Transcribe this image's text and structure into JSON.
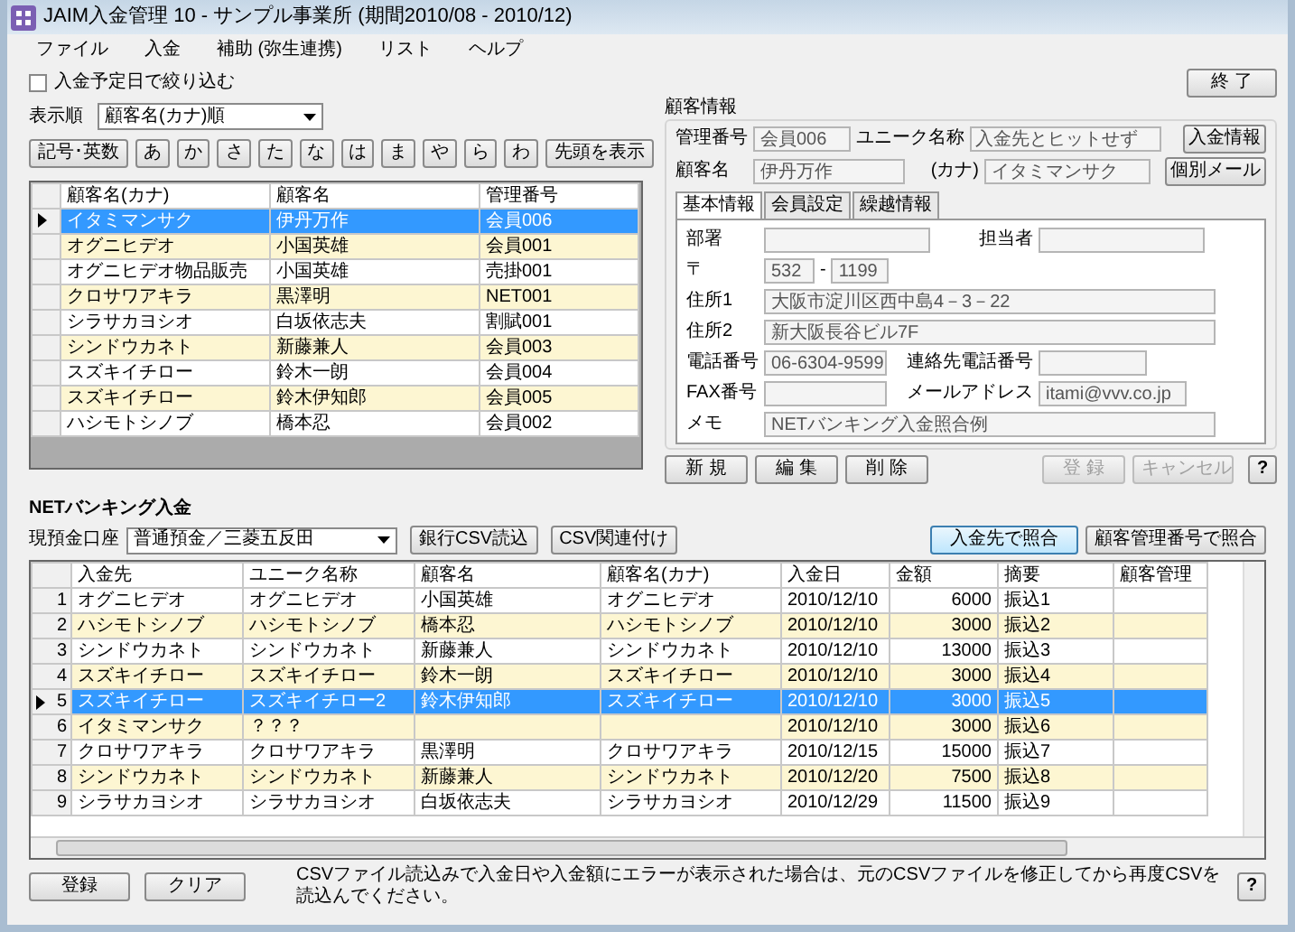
{
  "window": {
    "title": "JAIM入金管理 10  - サンプル事業所 (期間2010/08 - 2010/12)"
  },
  "menu": [
    "ファイル",
    "入金",
    "補助 (弥生連携)",
    "リスト",
    "ヘルプ"
  ],
  "filter": {
    "label": "入金予定日で絞り込む",
    "checked": false
  },
  "sort": {
    "label": "表示順",
    "value": "顧客名(カナ)順"
  },
  "index_buttons": [
    "記号･英数",
    "あ",
    "か",
    "さ",
    "た",
    "な",
    "は",
    "ま",
    "や",
    "ら",
    "わ"
  ],
  "show_top_button": "先頭を表示",
  "customers": {
    "columns": [
      "顧客名(カナ)",
      "顧客名",
      "管理番号"
    ],
    "rows": [
      {
        "cells": [
          "イタミマンサク",
          "伊丹万作",
          "会員006"
        ],
        "selected": true
      },
      {
        "cells": [
          "オグニヒデオ",
          "小国英雄",
          "会員001"
        ],
        "selected": false
      },
      {
        "cells": [
          "オグニヒデオ物品販売",
          "小国英雄",
          "売掛001"
        ],
        "selected": false
      },
      {
        "cells": [
          "クロサワアキラ",
          "黒澤明",
          "NET001"
        ],
        "selected": false
      },
      {
        "cells": [
          "シラサカヨシオ",
          "白坂依志夫",
          "割賦001"
        ],
        "selected": false
      },
      {
        "cells": [
          "シンドウカネト",
          "新藤兼人",
          "会員003"
        ],
        "selected": false
      },
      {
        "cells": [
          "スズキイチロー",
          "鈴木一朗",
          "会員004"
        ],
        "selected": false
      },
      {
        "cells": [
          "スズキイチロー",
          "鈴木伊知郎",
          "会員005"
        ],
        "selected": false
      },
      {
        "cells": [
          "ハシモトシノブ",
          "橋本忍",
          "会員002"
        ],
        "selected": false
      }
    ]
  },
  "exit_button": "終 了",
  "customer_info": {
    "title": "顧客情報",
    "management_no": {
      "label": "管理番号",
      "value": "会員006"
    },
    "unique_name": {
      "label": "ユニーク名称",
      "value": "入金先とヒットせず"
    },
    "name": {
      "label": "顧客名",
      "value": "伊丹万作"
    },
    "kana": {
      "label": "(カナ)",
      "value": "イタミマンサク"
    },
    "side_buttons": [
      "入金情報",
      "個別メール"
    ],
    "tabs": [
      {
        "label": "基本情報",
        "selected": true
      },
      {
        "label": "会員設定",
        "selected": false
      },
      {
        "label": "繰越情報",
        "selected": false
      }
    ],
    "department": {
      "label": "部署"
    },
    "person": {
      "label": "担当者"
    },
    "postal": {
      "label": "〒",
      "first": "532",
      "separator": "-",
      "second": "1199"
    },
    "address1": {
      "label": "住所1",
      "value": "大阪市淀川区西中島4－3－22"
    },
    "address2": {
      "label": "住所2",
      "value": "新大阪長谷ビル7F"
    },
    "phone": {
      "label": "電話番号",
      "value": "06-6304-9599"
    },
    "contact_phone": {
      "label": "連絡先電話番号"
    },
    "fax": {
      "label": "FAX番号"
    },
    "email": {
      "label": "メールアドレス",
      "value": "itami@vvv.co.jp"
    },
    "memo": {
      "label": "メモ",
      "value": "NETバンキング入金照合例"
    },
    "buttons": [
      {
        "label": "新 規",
        "disabled": false
      },
      {
        "label": "編 集",
        "disabled": false
      },
      {
        "label": "削 除",
        "disabled": false
      },
      {
        "label": "登 録",
        "disabled": true
      },
      {
        "label": "キャンセル",
        "disabled": true
      }
    ],
    "help": "?"
  },
  "net_banking": {
    "title": "NETバンキング入金",
    "account": {
      "label": "現預金口座",
      "value": "普通預金／三菱五反田"
    },
    "csv_buttons": [
      "銀行CSV読込",
      "CSV関連付け"
    ],
    "match_buttons": [
      {
        "label": "入金先で照合",
        "focused": true
      },
      {
        "label": "顧客管理番号で照合",
        "focused": false
      }
    ],
    "table": {
      "columns": [
        "入金先",
        "ユニーク名称",
        "顧客名",
        "顧客名(カナ)",
        "入金日",
        "金額",
        "摘要",
        "顧客管理"
      ],
      "rows": [
        {
          "number": "1",
          "cells": [
            "オグニヒデオ",
            "オグニヒデオ",
            "小国英雄",
            "オグニヒデオ",
            "2010/12/10",
            "6000",
            "振込1"
          ],
          "selected": false
        },
        {
          "number": "2",
          "cells": [
            "ハシモトシノブ",
            "ハシモトシノブ",
            "橋本忍",
            "ハシモトシノブ",
            "2010/12/10",
            "3000",
            "振込2"
          ],
          "selected": false
        },
        {
          "number": "3",
          "cells": [
            "シンドウカネト",
            "シンドウカネト",
            "新藤兼人",
            "シンドウカネト",
            "2010/12/10",
            "13000",
            "振込3"
          ],
          "selected": false
        },
        {
          "number": "4",
          "cells": [
            "スズキイチロー",
            "スズキイチロー",
            "鈴木一朗",
            "スズキイチロー",
            "2010/12/10",
            "3000",
            "振込4"
          ],
          "selected": false
        },
        {
          "number": "5",
          "cells": [
            "スズキイチロー",
            "スズキイチロー2",
            "鈴木伊知郎",
            "スズキイチロー",
            "2010/12/10",
            "3000",
            "振込5"
          ],
          "selected": true
        },
        {
          "number": "6",
          "cells": [
            "イタミマンサク",
            "？？？",
            null,
            null,
            "2010/12/10",
            "3000",
            "振込6"
          ],
          "selected": false
        },
        {
          "number": "7",
          "cells": [
            "クロサワアキラ",
            "クロサワアキラ",
            "黒澤明",
            "クロサワアキラ",
            "2010/12/15",
            "15000",
            "振込7"
          ],
          "selected": false
        },
        {
          "number": "8",
          "cells": [
            "シンドウカネト",
            "シンドウカネト",
            "新藤兼人",
            "シンドウカネト",
            "2010/12/20",
            "7500",
            "振込8"
          ],
          "selected": false
        },
        {
          "number": "9",
          "cells": [
            "シラサカヨシオ",
            "シラサカヨシオ",
            "白坂依志夫",
            "シラサカヨシオ",
            "2010/12/29",
            "11500",
            "振込9"
          ],
          "selected": false
        }
      ]
    },
    "buttons": [
      "登録",
      "クリア"
    ],
    "note": "CSVファイル読込みで入金日や入金額にエラーが表示された場合は、元のCSVファイルを修正してから再度CSVを読込んでください。",
    "help": "?"
  }
}
